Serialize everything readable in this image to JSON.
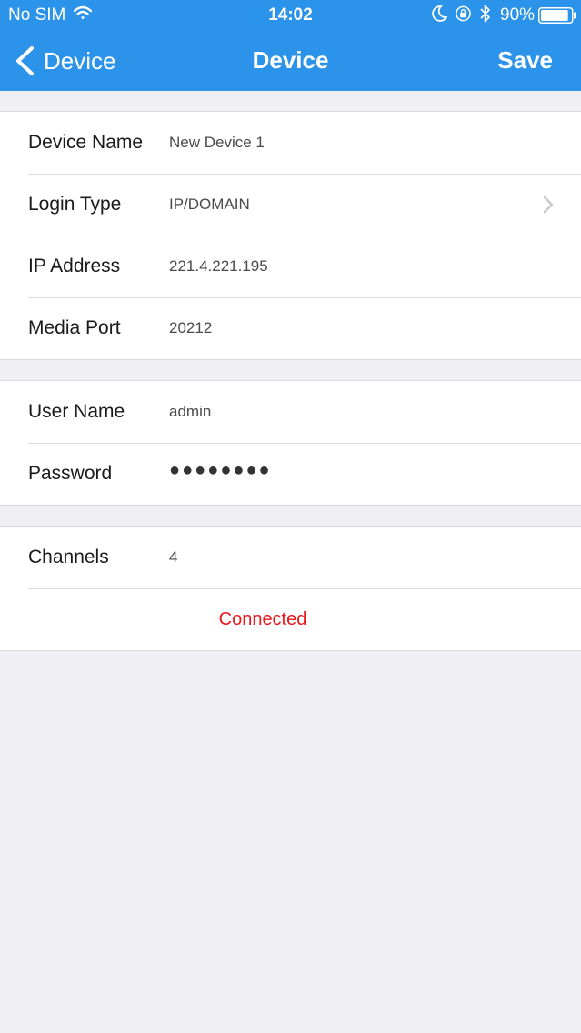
{
  "status_bar": {
    "carrier": "No SIM",
    "time": "14:02",
    "battery": "90%",
    "battery_level": 0.9,
    "icons": [
      "wifi-icon",
      "moon-icon",
      "rotation-lock-icon",
      "bluetooth-icon",
      "battery-icon"
    ]
  },
  "nav": {
    "back_label": "Device",
    "title": "Device",
    "save_label": "Save",
    "color": "#2c93ea"
  },
  "connection": {
    "device_name_label": "Device Name",
    "device_name_value": "New Device 1",
    "login_type_label": "Login Type",
    "login_type_value": "IP/DOMAIN",
    "ip_address_label": "IP Address",
    "ip_address_value": "221.4.221.195",
    "media_port_label": "Media Port",
    "media_port_value": "20212"
  },
  "credentials": {
    "user_name_label": "User Name",
    "user_name_value": "admin",
    "password_label": "Password",
    "password_value": "●●●●●●●●"
  },
  "device_info": {
    "channels_label": "Channels",
    "channels_value": "4",
    "status_text": "Connected",
    "status_color": "#e8171c"
  }
}
